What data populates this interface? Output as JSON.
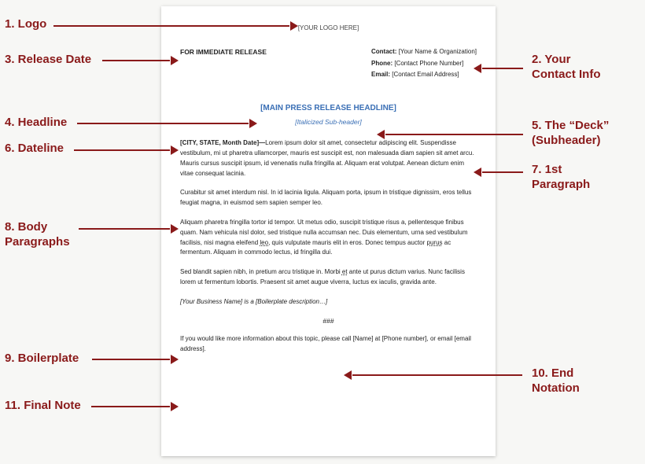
{
  "labels": {
    "l1": "1. Logo",
    "l2": "2. Your\nContact Info",
    "l3": "3. Release Date",
    "l4": "4. Headline",
    "l5": "5. The “Deck”\n(Subheader)",
    "l6": "6. Dateline",
    "l7": "7. 1st\nParagraph",
    "l8": "8. Body\nParagraphs",
    "l9": "9. Boilerplate",
    "l10": "10. End\nNotation",
    "l11": "11. Final Note"
  },
  "doc": {
    "logo": "[YOUR LOGO HERE]",
    "release": "FOR IMMEDIATE RELEASE",
    "contact": {
      "contact_label": "Contact:",
      "contact_val": "[Your Name & Organization]",
      "phone_label": "Phone:",
      "phone_val": "[Contact Phone Number]",
      "email_label": "Email:",
      "email_val": "[Contact Email Address]"
    },
    "headline": "[MAIN PRESS RELEASE HEADLINE]",
    "deck": "[Italicized Sub-header]",
    "dateline": "[CITY, STATE, Month Date]—",
    "para1": "Lorem ipsum dolor sit amet, consectetur adipiscing elit. Suspendisse vestibulum, mi ut pharetra ullamcorper, mauris est suscipit est, non malesuada diam sapien sit amet arcu. Mauris cursus suscipit ipsum, id venenatis nulla fringilla at. Aliquam erat volutpat. Aenean dictum enim vitae consequat lacinia.",
    "para2": "Curabitur sit amet interdum nisl. In id lacinia ligula. Aliquam porta, ipsum in tristique dignissim, eros tellus feugiat magna, in euismod sem sapien semper leo.",
    "para3a": "Aliquam pharetra fringilla tortor id tempor. Ut metus odio, suscipit tristique risus a, pellentesque finibus quam. Nam vehicula nisl dolor, sed tristique nulla accumsan nec. Duis elementum, urna sed vestibulum facilisis, nisi magna eleifend ",
    "para3u1": "leo,",
    "para3b": " quis vulputate mauris elit in eros. Donec tempus auctor ",
    "para3u2": "purus",
    "para3c": " ac fermentum. Aliquam in commodo lectus, id fringilla dui.",
    "para4a": "Sed blandit sapien nibh, in pretium arcu tristique in. Morbi ",
    "para4u": "et",
    "para4b": " ante ut purus dictum varius. Nunc facilisis lorem ut fermentum lobortis. Praesent sit amet augue viverra, luctus ex iaculis, gravida ante.",
    "boiler": "[Your Business Name] is a [Boilerplate description…]",
    "endnot": "###",
    "final": "If you would like more information about this topic, please call [Name] at [Phone number], or email [email address]."
  }
}
